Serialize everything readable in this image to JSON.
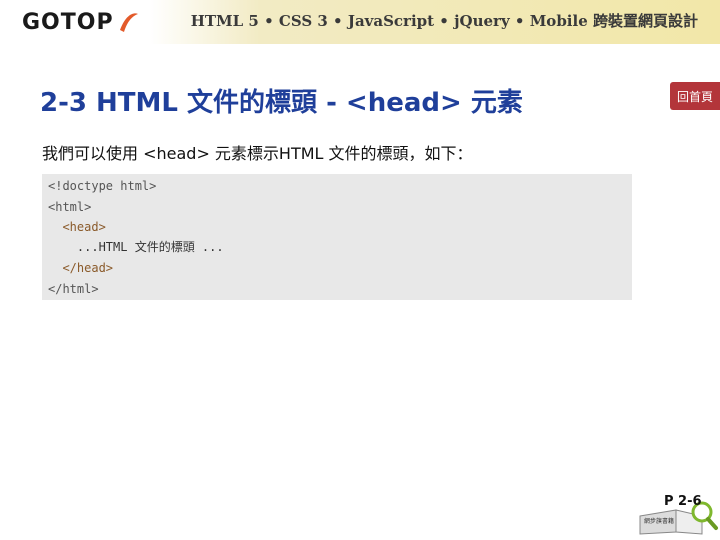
{
  "header": {
    "logo_text": "GOTOP",
    "course_text": "HTML 5 • CSS 3 • JavaScript • jQuery • Mobile",
    "course_text_cjk": "跨裝置網頁設計"
  },
  "slide": {
    "title": "2-3  HTML 文件的標頭 - <head> 元素",
    "home_label": "回首頁",
    "intro": "我們可以使用 <head>  元素標示HTML 文件的標頭，如下："
  },
  "code": {
    "lines": [
      "<!doctype html>",
      "<html>",
      "  <head>",
      "    ...HTML 文件的標頭 ...",
      "  </head>",
      "</html>"
    ]
  },
  "footer": {
    "page_number": "P 2-6",
    "book_caption": "網步旗書籍"
  },
  "colors": {
    "title": "#1f3f9a",
    "home_button": "#b3353a",
    "banner": "#f2e7a8",
    "code_bg": "#e8e8e8"
  }
}
